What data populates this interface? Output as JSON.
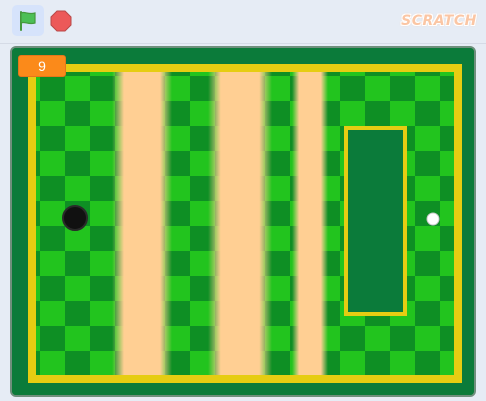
{
  "toolbar": {
    "green_flag_icon": "green-flag-icon",
    "stop_icon": "stop-sign-icon",
    "logo_text": "SCRATCH"
  },
  "stage": {
    "score_value": "9"
  },
  "colors": {
    "board_dark": "#0b7b3a",
    "check_light": "#22c41e",
    "check_dark": "#0e8f24",
    "sand": "#ffcf93",
    "rail": "#e6cd12",
    "score_bg": "#fb8a1a",
    "flag": "#4cbf56",
    "stop": "#ec5959"
  }
}
